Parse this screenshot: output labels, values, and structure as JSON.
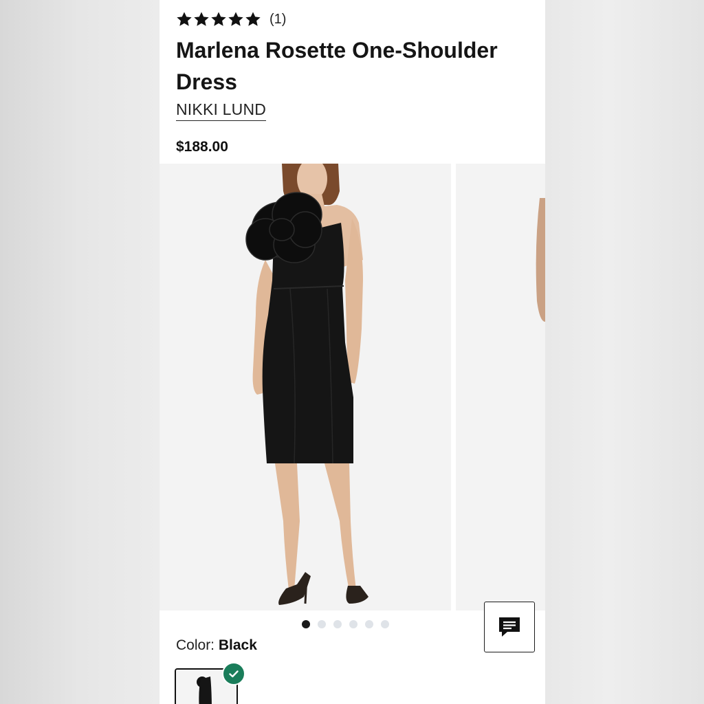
{
  "product": {
    "rating_stars": 5,
    "rating_count": "(1)",
    "title": "Marlena Rosette One-Shoulder Dress",
    "brand": "NIKKI LUND",
    "price": "$188.00"
  },
  "gallery": {
    "slide_count": 6,
    "active_slide": 1
  },
  "color": {
    "label": "Color:",
    "value": "Black"
  },
  "icons": {
    "star": "star-icon",
    "chat": "chat-icon",
    "check": "check-icon"
  },
  "colors": {
    "check_badge": "#1a7d5a",
    "active_dot": "#1a1a1a",
    "inactive_dot": "#dfe3e8"
  }
}
